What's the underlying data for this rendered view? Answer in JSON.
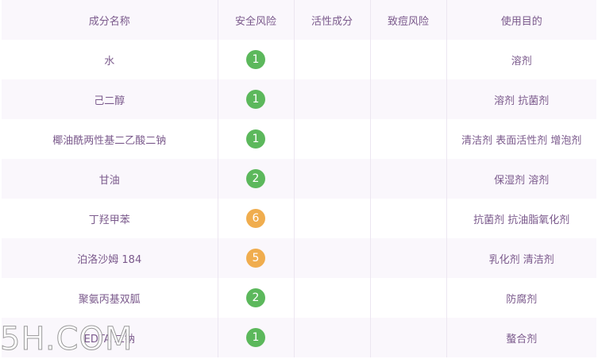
{
  "colors": {
    "risk_1": "#5cb85c",
    "risk_2": "#5cb85c",
    "risk_5": "#f0ad4e",
    "risk_6": "#f0ad4e"
  },
  "headers": [
    "成分名称",
    "安全风险",
    "活性成分",
    "致痘风险",
    "使用目的"
  ],
  "rows": [
    {
      "name": "水",
      "risk": "1",
      "active": "",
      "acne": "",
      "purpose": "溶剂"
    },
    {
      "name": "己二醇",
      "risk": "1",
      "active": "",
      "acne": "",
      "purpose": "溶剂 抗菌剂"
    },
    {
      "name": "椰油酰两性基二乙酸二钠",
      "risk": "1",
      "active": "",
      "acne": "",
      "purpose": "清洁剂 表面活性剂 增泡剂"
    },
    {
      "name": "甘油",
      "risk": "2",
      "active": "",
      "acne": "",
      "purpose": "保湿剂 溶剂"
    },
    {
      "name": "丁羟甲苯",
      "risk": "6",
      "active": "",
      "acne": "",
      "purpose": "抗菌剂 抗油脂氧化剂"
    },
    {
      "name": "泊洛沙姆 184",
      "risk": "5",
      "active": "",
      "acne": "",
      "purpose": "乳化剂 清洁剂"
    },
    {
      "name": "聚氨丙基双胍",
      "risk": "2",
      "active": "",
      "acne": "",
      "purpose": "防腐剂"
    },
    {
      "name": "EDTA 二钠",
      "risk": "1",
      "active": "",
      "acne": "",
      "purpose": "螯合剂"
    }
  ],
  "watermark": "5H.COM"
}
